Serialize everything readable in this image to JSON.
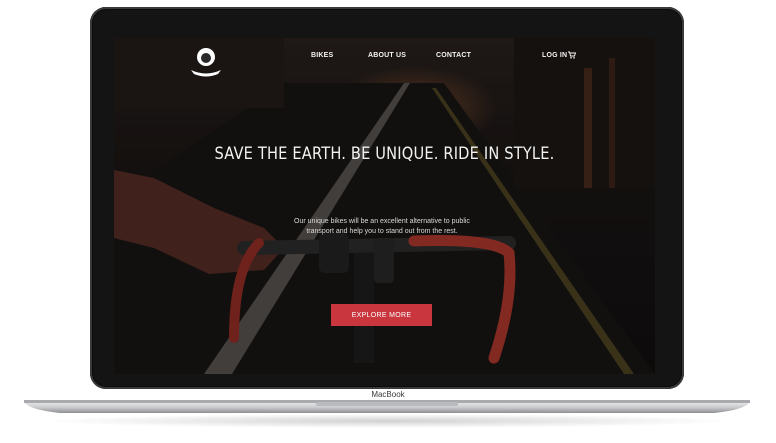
{
  "nav": {
    "logo_icon": "lion-head-icon",
    "items": [
      {
        "label": "BIKES"
      },
      {
        "label": "ABOUT US"
      },
      {
        "label": "CONTACT"
      }
    ],
    "login_label": "LOG IN",
    "cart_icon": "cart-icon"
  },
  "hero": {
    "title": "SAVE THE EARTH. BE UNIQUE. RIDE IN STYLE.",
    "subtitle_line1": "Our unique bikes will be an excellent alternative to public",
    "subtitle_line2": "transport and help you to stand out from the rest.",
    "cta_label": "EXPLORE MORE"
  },
  "device": {
    "label": "MacBook"
  },
  "colors": {
    "accent": "#c9363d",
    "bezel": "#141414",
    "text": "#f4f4f4"
  }
}
